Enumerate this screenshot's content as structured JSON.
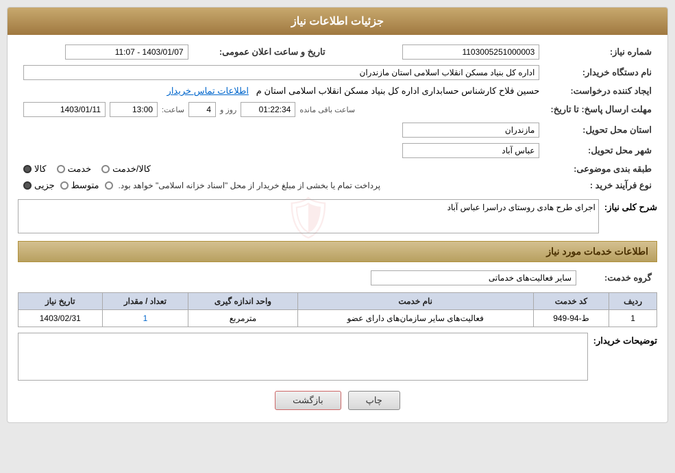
{
  "header": {
    "title": "جزئیات اطلاعات نیاز"
  },
  "fields": {
    "need_number_label": "شماره نیاز:",
    "need_number_value": "1103005251000003",
    "announce_date_label": "تاریخ و ساعت اعلان عمومی:",
    "announce_date_value": "1403/01/07 - 11:07",
    "buyer_org_label": "نام دستگاه خریدار:",
    "buyer_org_value": "اداره کل بنیاد مسکن انقلاب اسلامی استان مازندران",
    "creator_label": "ایجاد کننده درخواست:",
    "creator_value": "حسین فلاح کارشناس حسابداری اداره کل بنیاد مسکن انقلاب اسلامی استان م",
    "creator_link": "اطلاعات تماس خریدار",
    "deadline_label": "مهلت ارسال پاسخ: تا تاریخ:",
    "deadline_date": "1403/01/11",
    "deadline_time_label": "ساعت:",
    "deadline_time": "13:00",
    "deadline_days_label": "روز و",
    "deadline_days": "4",
    "deadline_remaining_label": "ساعت باقی مانده",
    "deadline_remaining": "01:22:34",
    "province_label": "استان محل تحویل:",
    "province_value": "مازندران",
    "city_label": "شهر محل تحویل:",
    "city_value": "عباس آباد",
    "category_label": "طبقه بندی موضوعی:",
    "category_options": [
      "کالا",
      "خدمت",
      "کالا/خدمت"
    ],
    "category_selected": "کالا",
    "process_label": "نوع فرآیند خرید :",
    "process_options": [
      "جزیی",
      "متوسط",
      "پرداخت تمام یا بخشی از مبلغ خریدار از محل \"اسناد خزانه اسلامی\" خواهد بود."
    ],
    "process_selected": "جزیی",
    "process_note": "پرداخت تمام یا بخشی از مبلغ خریدار از محل \"اسناد خزانه اسلامی\" خواهد بود.",
    "description_label": "شرح کلی نیاز:",
    "description_value": "اجرای طرح هادی روستای دراسرا عباس آباد",
    "services_section_title": "اطلاعات خدمات مورد نیاز",
    "service_group_label": "گروه خدمت:",
    "service_group_value": "سایر فعالیت‌های خدماتی",
    "table_headers": [
      "ردیف",
      "کد خدمت",
      "نام خدمت",
      "واحد اندازه گیری",
      "تعداد / مقدار",
      "تاریخ نیاز"
    ],
    "table_rows": [
      {
        "row": "1",
        "code": "ط-94-949",
        "name": "فعالیت‌های سایر سازمان‌های دارای عضو",
        "unit": "مترمربع",
        "qty": "1",
        "date": "1403/02/31"
      }
    ],
    "buyer_notes_label": "توضیحات خریدار:",
    "buyer_notes_value": "",
    "btn_print": "چاپ",
    "btn_back": "بازگشت"
  }
}
